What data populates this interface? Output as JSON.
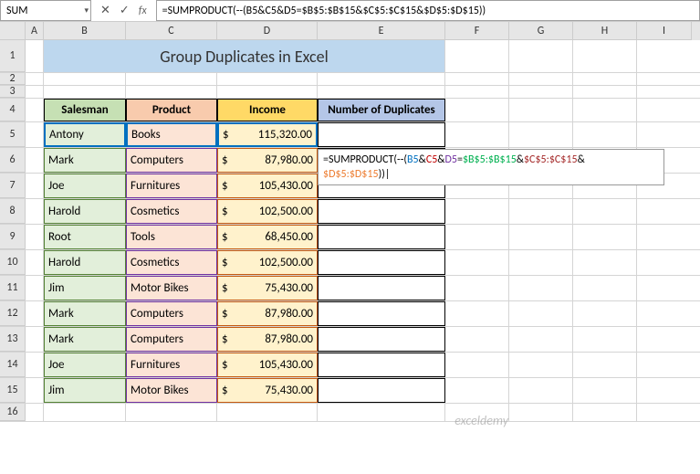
{
  "name_box": "SUM",
  "formula_bar": "=SUMPRODUCT(--(B5&C5&D5=$B$5:$B$15&$C$5:$C$15&$D$5:$D$15))",
  "title": "Group Duplicates in Excel",
  "columns": [
    "A",
    "B",
    "C",
    "D",
    "E",
    "F",
    "G",
    "H",
    "I"
  ],
  "row_numbers": [
    "1",
    "2",
    "3",
    "4",
    "5",
    "6",
    "7",
    "8",
    "9",
    "10",
    "11",
    "12",
    "13",
    "14",
    "15",
    "16"
  ],
  "headers": {
    "b": "Salesman",
    "c": "Product",
    "d": "Income",
    "e": "Number of Duplicates"
  },
  "rows": [
    {
      "b": "Antony",
      "c": "Books",
      "d": "115,320.00"
    },
    {
      "b": "Mark",
      "c": "Computers",
      "d": "87,980.00"
    },
    {
      "b": "Joe",
      "c": "Furnitures",
      "d": "105,430.00"
    },
    {
      "b": "Harold",
      "c": "Cosmetics",
      "d": "102,500.00"
    },
    {
      "b": "Root",
      "c": "Tools",
      "d": "68,450.00"
    },
    {
      "b": "Harold",
      "c": "Cosmetics",
      "d": "102,500.00"
    },
    {
      "b": "Jim",
      "c": "Motor Bikes",
      "d": "75,430.00"
    },
    {
      "b": "Mark",
      "c": "Computers",
      "d": "87,980.00"
    },
    {
      "b": "Mark",
      "c": "Computers",
      "d": "87,980.00"
    },
    {
      "b": "Joe",
      "c": "Furnitures",
      "d": "105,430.00"
    },
    {
      "b": "Jim",
      "c": "Motor Bikes",
      "d": "75,430.00"
    }
  ],
  "currency": "$",
  "formula_parts": {
    "p1": "=SUMPRODUCT(--(",
    "p2": "B5",
    "amp": "&",
    "p3": "C5",
    "p4": "D5",
    "eq": "=",
    "p5": "$B$5:$B$15",
    "p6": "$C$5:$C$15",
    "p7": "$D$5:$D$15",
    "p8": "))"
  },
  "watermark": "exceldemy",
  "icons": {
    "cancel": "✕",
    "enter": "✓",
    "fx": "fx",
    "dd": "▾"
  }
}
